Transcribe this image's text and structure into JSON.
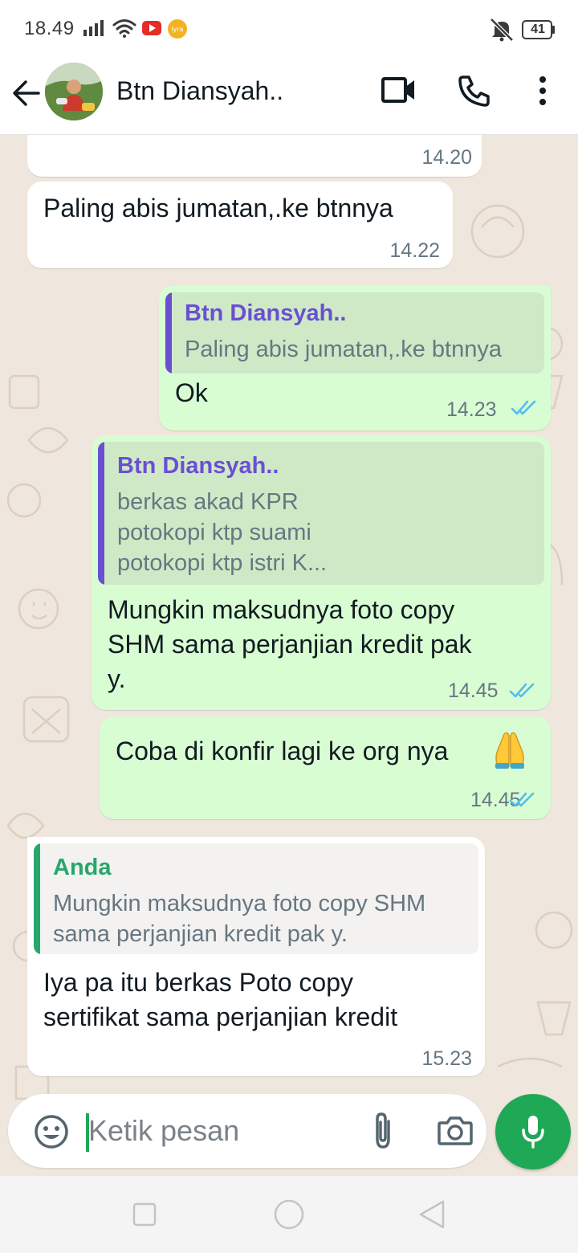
{
  "status_bar": {
    "time": "18.49",
    "battery": "41",
    "icons": [
      "signal-icon",
      "wifi-icon",
      "youtube-icon",
      "app-badge-icon",
      "mute-icon",
      "battery-icon"
    ]
  },
  "header": {
    "contact_name": "Btn Diansyah..",
    "icons": [
      "back-arrow-icon",
      "video-call-icon",
      "voice-call-icon",
      "more-vertical-icon"
    ]
  },
  "messages": [
    {
      "direction": "in",
      "text": "",
      "time": "14.20"
    },
    {
      "direction": "in",
      "text": "Paling abis jumatan,.ke btnnya",
      "time": "14.22"
    },
    {
      "direction": "out",
      "quote": {
        "author": "Btn Diansyah..",
        "text": "Paling abis jumatan,.ke btnnya"
      },
      "text": "Ok",
      "time": "14.23",
      "status": "read"
    },
    {
      "direction": "out",
      "quote": {
        "author": "Btn Diansyah..",
        "text": "berkas akad KPR\npotokopi ktp suami\npotokopi ktp istri K..."
      },
      "text": "Mungkin maksudnya foto copy\nSHM sama perjanjian kredit pak\ny.",
      "time": "14.45",
      "status": "read"
    },
    {
      "direction": "out",
      "text": "Coba di konfir lagi ke org nya",
      "emoji": "folded-hands-emoji",
      "time": "14.45",
      "status": "read"
    },
    {
      "direction": "in",
      "quote": {
        "author": "Anda",
        "text": "Mungkin maksudnya foto copy SHM\nsama perjanjian kredit pak y."
      },
      "text": "Iya pa itu berkas Poto copy\nsertifikat sama perjanjian kredit",
      "time": "15.23"
    }
  ],
  "composer": {
    "placeholder": "Ketik pesan",
    "icons": [
      "emoji-icon",
      "attach-icon",
      "camera-icon",
      "mic-icon"
    ]
  },
  "nav": {
    "icons": [
      "recent-apps-icon",
      "home-icon",
      "back-triangle-icon"
    ]
  },
  "colors": {
    "outgoing_bubble": "#d9fdd3",
    "incoming_bubble": "#ffffff",
    "read_tick": "#53bdeb",
    "accent_green": "#1fa855",
    "quote_author_contact": "#6a4fd2",
    "quote_author_self": "#27a76b",
    "wallpaper": "#efe7dd"
  }
}
